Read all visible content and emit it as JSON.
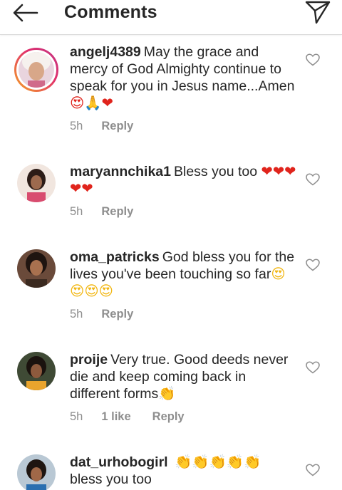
{
  "header": {
    "title": "Comments",
    "back_icon": "arrow-left-icon",
    "send_icon": "paper-plane-icon"
  },
  "comments": [
    {
      "username": "angelj4389",
      "text": "May the grace and mercy of God Almighty continue to speak for you in Jesus name...Amen",
      "emoji": "😍🙏❤",
      "time": "5h",
      "reply": "Reply",
      "has_story_ring": true
    },
    {
      "username": "maryannchika1",
      "text": "Bless you too",
      "emoji": "❤❤❤❤❤",
      "time": "5h",
      "reply": "Reply"
    },
    {
      "username": "oma_patricks",
      "text": "God bless you for the lives you've been touching so far",
      "emoji": "😍😍😍😍",
      "time": "5h",
      "reply": "Reply"
    },
    {
      "username": "proije",
      "text": "Very true. Good deeds never die and keep coming back in different forms",
      "emoji": "👏",
      "time": "5h",
      "likes": "1 like",
      "reply": "Reply"
    },
    {
      "username": "dat_urhobogirl",
      "text": "bless you too",
      "emoji": "👏👏👏👏👏",
      "time": "",
      "reply": ""
    }
  ],
  "colors": {
    "text": "#262626",
    "meta": "#8e8e8e",
    "divider": "#dbdbdb",
    "heart_emoji": "#e0241c",
    "story_ring_start": "#f5a623",
    "story_ring_end": "#c13584"
  }
}
